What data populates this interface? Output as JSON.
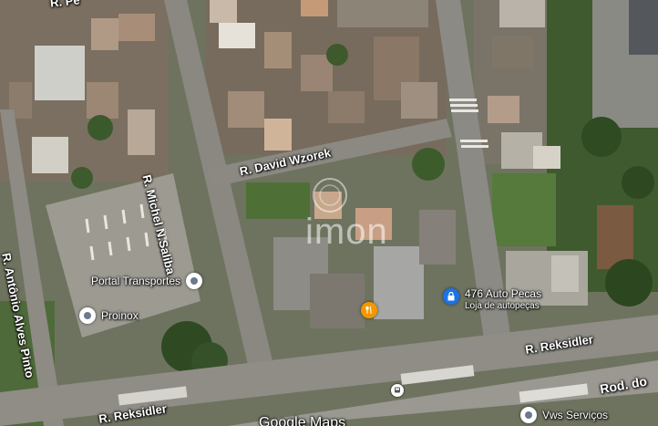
{
  "map": {
    "streets": {
      "top": "R. Pe",
      "michel": "R. Michel N.Saliba",
      "david": "R. David Wzorek",
      "antonio": "R. Antônio Alves Pinto",
      "reksidler_left": "R. Reksidler",
      "reksidler_right": "R. Reksidler",
      "rod": "Rod. do"
    },
    "pois": [
      {
        "name": "Portal Transportes",
        "subtitle": "",
        "icon": "place-pin-icon",
        "color": "#6b7b8c"
      },
      {
        "name": "Proinox",
        "subtitle": "",
        "icon": "place-pin-icon",
        "color": "#6b7b8c"
      },
      {
        "name": "476 Auto Pecas",
        "subtitle": "Loja de autopeças",
        "icon": "shopping-bag-icon",
        "color": "#1a73e8"
      },
      {
        "name": "",
        "subtitle": "",
        "icon": "restaurant-icon",
        "color": "#f29900"
      },
      {
        "name": "Vws Serviços",
        "subtitle": "",
        "icon": "place-pin-icon",
        "color": "#6b7b8c"
      }
    ],
    "watermark": "imon",
    "attribution": "Google Maps"
  }
}
